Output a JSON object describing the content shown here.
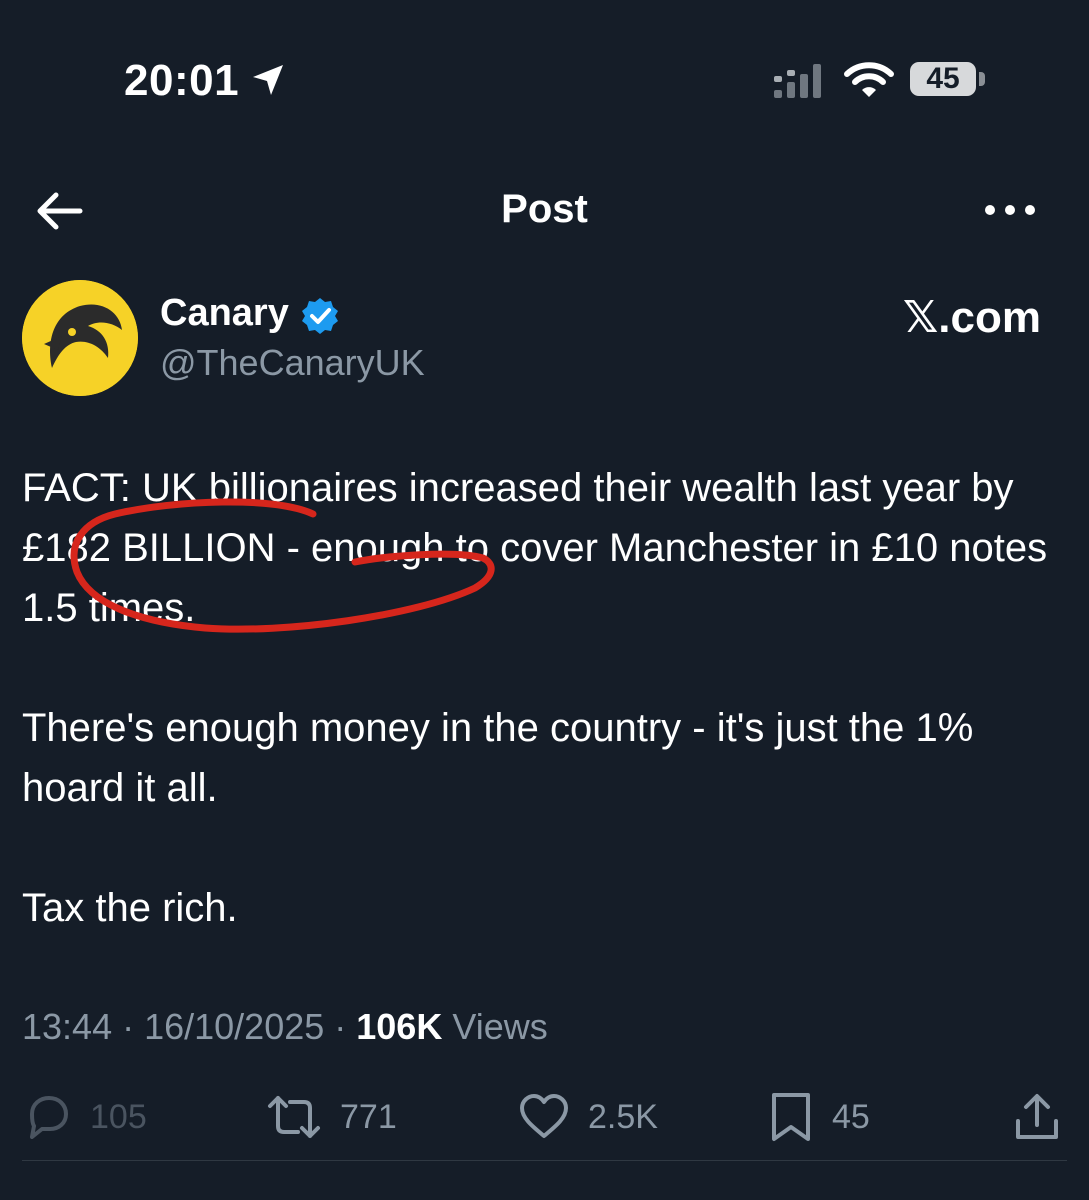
{
  "status_bar": {
    "time": "20:01",
    "battery_level": "45"
  },
  "nav": {
    "title": "Post"
  },
  "post": {
    "author": {
      "name": "Canary",
      "handle": "@TheCanaryUK",
      "verified": true
    },
    "watermark": "𝕏.com",
    "paragraphs": [
      "FACT: UK billionaires increased their wealth last year by £182 BILLION - enough to cover Manchester in £10 notes 1.5 times.",
      "There's enough money in the country - it's just the 1% hoard it all.",
      "Tax the rich."
    ],
    "timestamp": "13:44 · 16/10/2025 ·",
    "views_count": "106K",
    "views_label": "Views",
    "actions": {
      "replies": "105",
      "reposts": "771",
      "likes": "2.5K",
      "bookmarks": "45"
    }
  },
  "colors": {
    "background": "#151d28",
    "text": "#ffffff",
    "muted": "#8b98a5",
    "verified": "#1d9bf0",
    "avatar_bg": "#f6d227",
    "annotation": "#d6261c"
  },
  "icons": {
    "back": "arrow-left-icon",
    "more": "more-horizontal-icon",
    "verified": "verified-badge-icon",
    "reply": "reply-icon",
    "repost": "repost-icon",
    "like": "heart-icon",
    "bookmark": "bookmark-icon",
    "share": "share-icon"
  }
}
